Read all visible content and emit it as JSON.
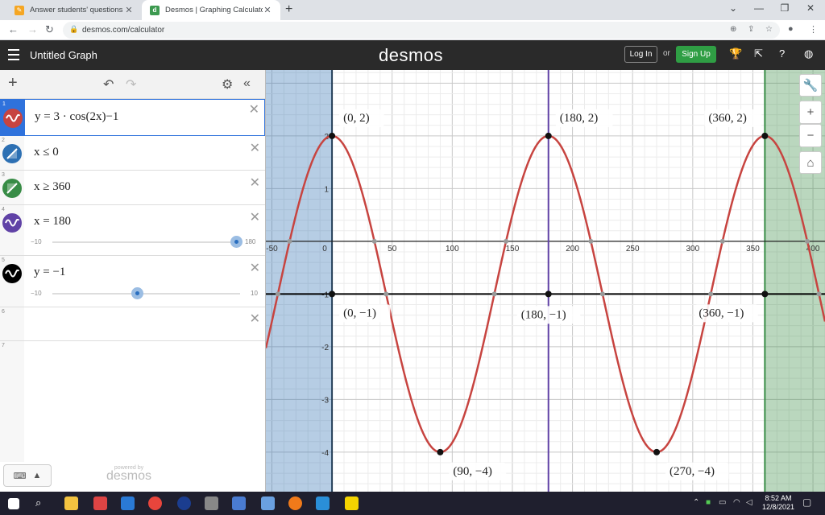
{
  "browser": {
    "tabs": [
      {
        "title": "Answer students' questions and",
        "active": false
      },
      {
        "title": "Desmos | Graphing Calculator",
        "active": true
      }
    ],
    "url": "desmos.com/calculator"
  },
  "header": {
    "graph_title": "Untitled Graph",
    "logo": "desmos",
    "login_label": "Log In",
    "or_label": "or",
    "signup_label": "Sign Up"
  },
  "expressions": [
    {
      "num": "1",
      "color": "#c74440",
      "latex": "y = 3 · cos(2x)−1"
    },
    {
      "num": "2",
      "color": "#2d70b3",
      "latex": "x ≤ 0"
    },
    {
      "num": "3",
      "color": "#388c46",
      "latex": "x ≥ 360"
    },
    {
      "num": "4",
      "color": "#6042a6",
      "latex": "x = 180",
      "slider": {
        "min": "−10",
        "max": "180",
        "value": 180
      }
    },
    {
      "num": "5",
      "color": "#000000",
      "latex": "y = −1",
      "slider": {
        "min": "−10",
        "max": "10",
        "value": -1
      }
    },
    {
      "num": "6"
    },
    {
      "num": "7"
    }
  ],
  "footer": {
    "powered_by": "powered by",
    "brand": "desmos"
  },
  "taskbar": {
    "time": "8:52 AM",
    "date": "12/8/2021"
  },
  "chart_data": {
    "type": "line",
    "function": "y = 3*cos(2x) - 1 (x in degrees)",
    "xlim": [
      -55,
      410
    ],
    "ylim": [
      -4.75,
      3.25
    ],
    "x_ticks": [
      "-50",
      "0",
      "50",
      "100",
      "150",
      "200",
      "250",
      "300",
      "350",
      "400"
    ],
    "y_ticks": [
      "2",
      "1",
      "-1",
      "-2",
      "-3",
      "-4"
    ],
    "shaded_regions": [
      {
        "condition": "x ≤ 0",
        "color": "#2d70b3"
      },
      {
        "condition": "x ≥ 360",
        "color": "#388c46"
      }
    ],
    "vertical_lines": [
      {
        "x": 180,
        "color": "#6042a6"
      }
    ],
    "horizontal_lines": [
      {
        "y": -1,
        "color": "#000000"
      }
    ],
    "labeled_points": [
      {
        "x": 0,
        "y": 2,
        "label": "(0, 2)"
      },
      {
        "x": 180,
        "y": 2,
        "label": "(180, 2)"
      },
      {
        "x": 360,
        "y": 2,
        "label": "(360, 2)"
      },
      {
        "x": 0,
        "y": -1,
        "label": "(0, −1)"
      },
      {
        "x": 180,
        "y": -1,
        "label": "(180, −1)"
      },
      {
        "x": 360,
        "y": -1,
        "label": "(360, −1)"
      },
      {
        "x": 90,
        "y": -4,
        "label": "(90, −4)"
      },
      {
        "x": 270,
        "y": -4,
        "label": "(270, −4)"
      }
    ]
  }
}
